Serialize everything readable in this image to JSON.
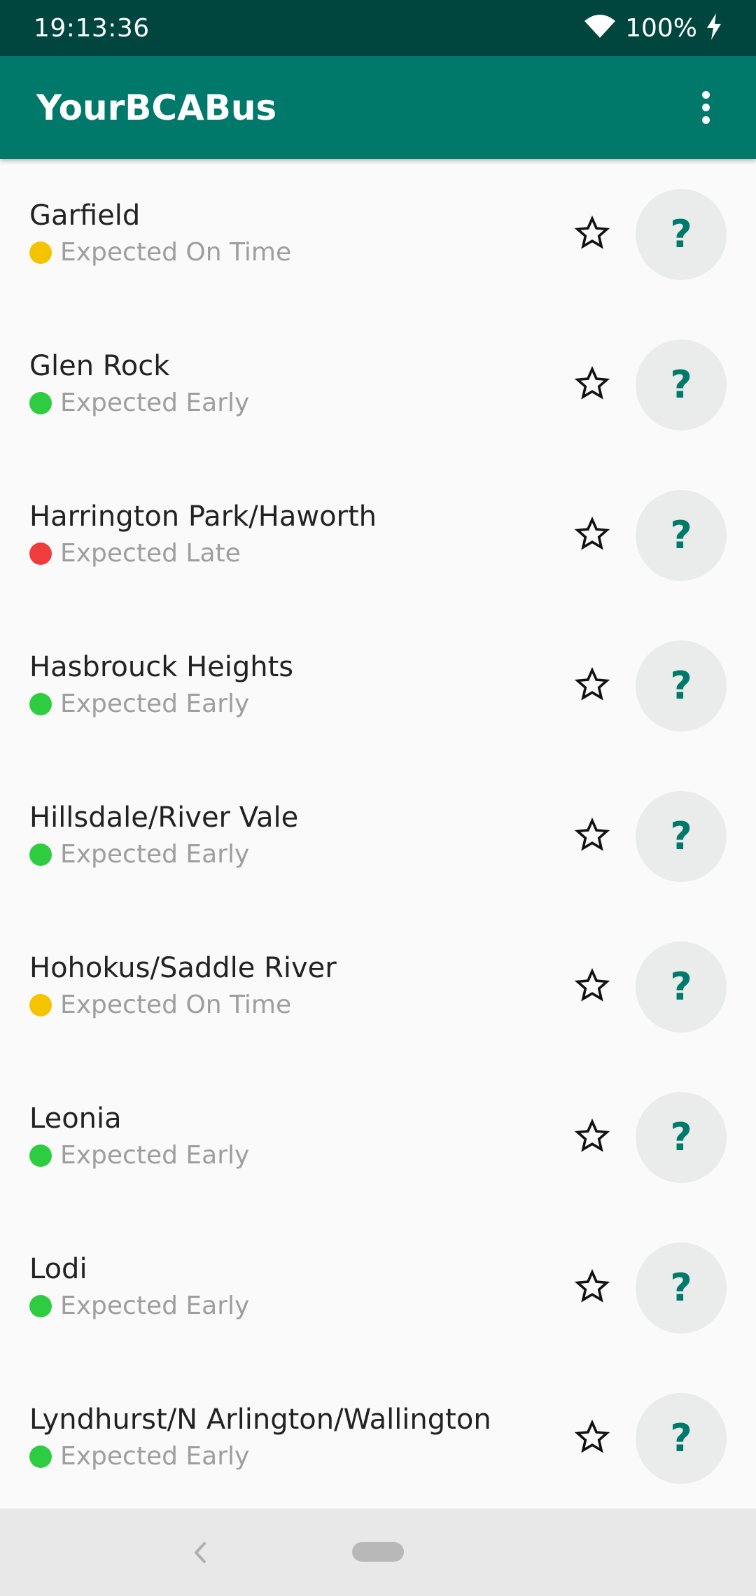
{
  "status_bar": {
    "time": "19:13:36",
    "battery": "100%",
    "icons": [
      "wifi-icon",
      "charging-icon"
    ]
  },
  "app_bar": {
    "title": "YourBCABus",
    "menu_icon": "more-vert-icon"
  },
  "colors": {
    "primary": "#00796b",
    "primary_dark": "#00463f",
    "on_time": "#f5c400",
    "early": "#2ecc40",
    "late": "#f03c3c"
  },
  "routes": [
    {
      "name": "Garfield",
      "status": "Expected On Time",
      "status_type": "on_time",
      "button": "?"
    },
    {
      "name": "Glen Rock",
      "status": "Expected Early",
      "status_type": "early",
      "button": "?"
    },
    {
      "name": "Harrington Park/Haworth",
      "status": "Expected Late",
      "status_type": "late",
      "button": "?"
    },
    {
      "name": "Hasbrouck Heights",
      "status": "Expected Early",
      "status_type": "early",
      "button": "?"
    },
    {
      "name": "Hillsdale/River Vale",
      "status": "Expected Early",
      "status_type": "early",
      "button": "?"
    },
    {
      "name": "Hohokus/Saddle River",
      "status": "Expected On Time",
      "status_type": "on_time",
      "button": "?"
    },
    {
      "name": "Leonia",
      "status": "Expected Early",
      "status_type": "early",
      "button": "?"
    },
    {
      "name": "Lodi",
      "status": "Expected Early",
      "status_type": "early",
      "button": "?"
    },
    {
      "name": "Lyndhurst/N Arlington/Wallington",
      "status": "Expected Early",
      "status_type": "early",
      "button": "?"
    }
  ],
  "nav_bar": {
    "icons": [
      "back-icon",
      "home-pill-icon"
    ]
  }
}
